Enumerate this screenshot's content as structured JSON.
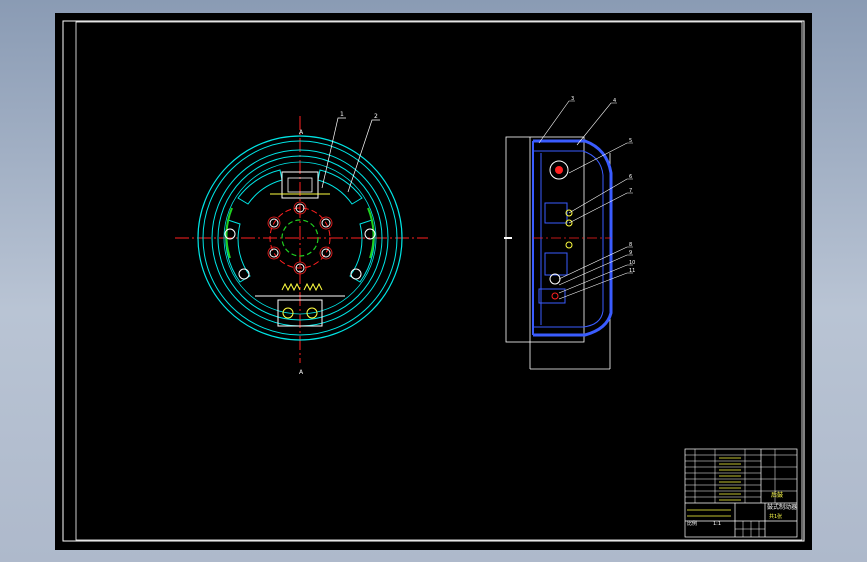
{
  "canvas": {
    "background": "#000000",
    "workspace": "#9aa8bf"
  },
  "colors": {
    "border": "#ffffff",
    "cyan": "#00e5e5",
    "blue": "#3a5cff",
    "red": "#ff2020",
    "green": "#20d020",
    "yellow": "#ffff40",
    "white": "#ffffff"
  },
  "front_view": {
    "leader_labels": [
      "1",
      "2"
    ],
    "section_marks": [
      "A",
      "A"
    ]
  },
  "side_view": {
    "leader_labels": [
      "3",
      "4",
      "5",
      "6",
      "7",
      "8",
      "9",
      "10",
      "11"
    ]
  },
  "title_block": {
    "part_name": "后鼓",
    "drawing_title": "鼓式制动器",
    "sheet": "1:1",
    "scale_note": "共1张",
    "org": "比例"
  }
}
